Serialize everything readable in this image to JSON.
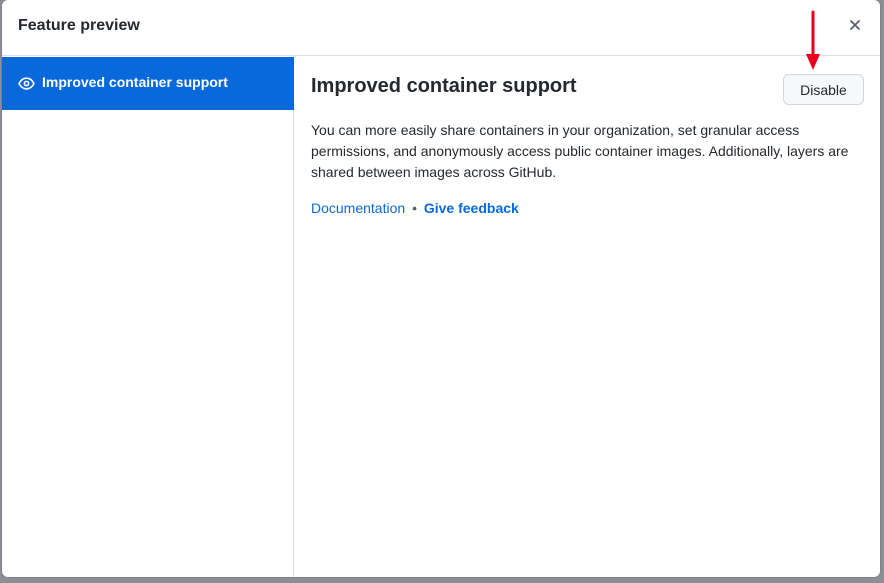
{
  "dialog": {
    "title": "Feature preview",
    "close_icon": "close-icon"
  },
  "sidebar": {
    "items": [
      {
        "label": "Improved container support",
        "icon": "eye-icon",
        "selected": true
      }
    ]
  },
  "main": {
    "title": "Improved container support",
    "disable_label": "Disable",
    "description": "You can more easily share containers in your organization, set granular access permissions, and anonymously access public container images. Additionally, layers are shared between images across GitHub.",
    "links": {
      "documentation": "Documentation",
      "separator": "•",
      "feedback": "Give feedback"
    }
  },
  "colors": {
    "accent": "#0969da",
    "annotation": "#e8001c"
  }
}
